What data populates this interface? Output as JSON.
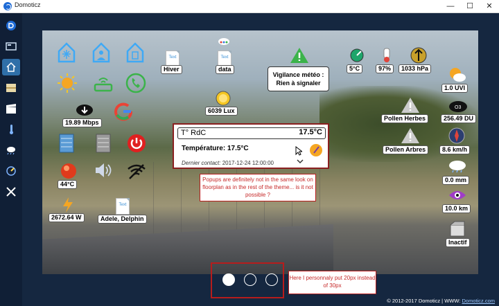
{
  "window": {
    "title": "Domoticz",
    "minimize": "—",
    "maximize": "☐",
    "close": "✕"
  },
  "sidebar": {
    "items": [
      {
        "name": "logo"
      },
      {
        "name": "dashboard"
      },
      {
        "name": "floorplans",
        "active": true
      },
      {
        "name": "switches"
      },
      {
        "name": "scenes"
      },
      {
        "name": "temperature"
      },
      {
        "name": "weather"
      },
      {
        "name": "utility"
      },
      {
        "name": "setup"
      }
    ]
  },
  "devices": {
    "hiver": "Hiver",
    "data": "data",
    "lux": "6039 Lux",
    "vigilance_line1": "Vigilance météo :",
    "vigilance_line2": "Rien à signaler",
    "temp": "5°C",
    "humidity": "97%",
    "pressure": "1033 hPa",
    "uvi": "1.0 UVI",
    "internet": "19.89 Mbps",
    "pollen_herbes": "Pollen Herbes",
    "du": "256.49 DU",
    "pollen_arbres": "Pollen Arbres",
    "wind": "8.6 km/h",
    "temp_room": "44°C",
    "rain": "0.0 mm",
    "visibility": "10.0 km",
    "power": "2672.64 W",
    "text_user": "Adele, Delphin",
    "inactif": "Inactif",
    "doc_text": "Text",
    "o3_label": "O3"
  },
  "popup": {
    "title": "T° RdC",
    "title_value": "17.5°C",
    "reading": "Température: 17.5°C",
    "contact_label": "Dernier contact:",
    "contact_time": "2017-12-24 12:00:00"
  },
  "annotations": {
    "popup_note": "Popups are definitely not in the same look on floorplan as in the rest of the theme... is it not possible ?",
    "dots_note": "Here I personnaly put 20px instead of 30px"
  },
  "footer": {
    "copyright": "© 2012-2017 Domoticz | WWW:",
    "link": "Domoticz.com"
  },
  "colors": {
    "accent": "#2f6fa8",
    "annotation": "#b71c1c",
    "background": "#152740"
  }
}
